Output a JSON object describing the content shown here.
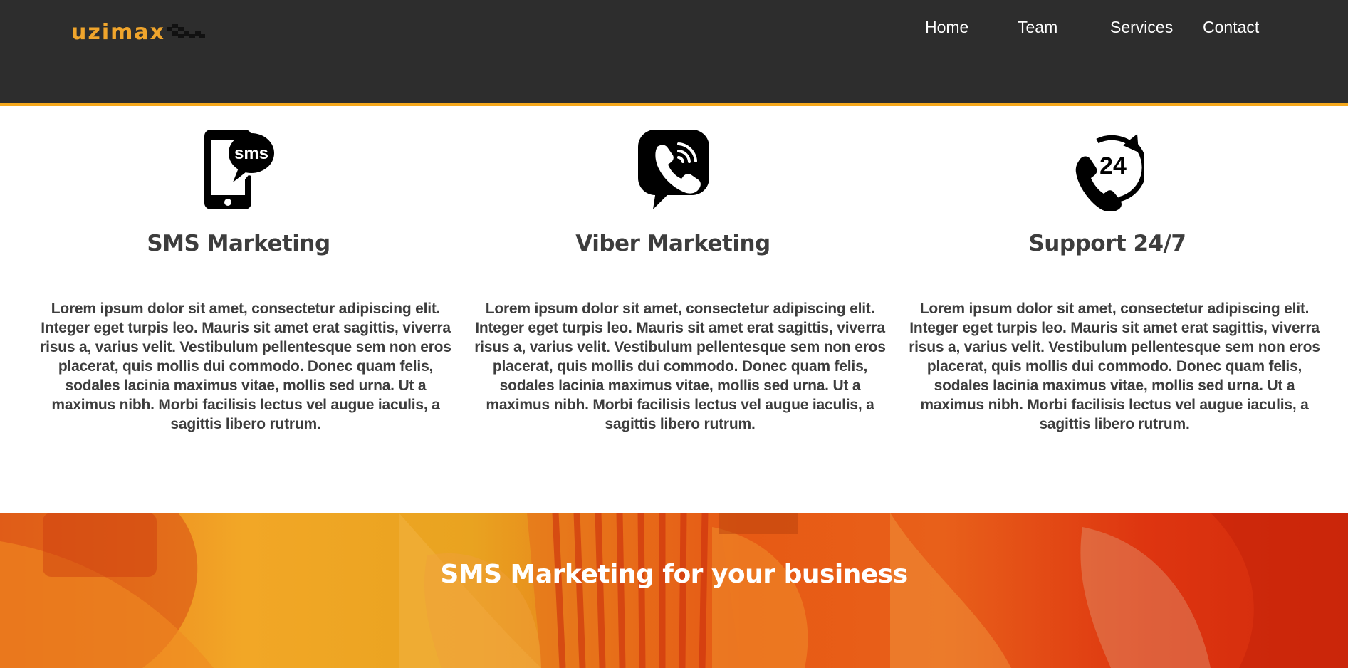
{
  "header": {
    "logo_text": "uzimax",
    "nav": {
      "home": "Home",
      "team": "Team",
      "services": "Services",
      "contact": "Contact"
    }
  },
  "colors": {
    "header_bg": "#2d2d2d",
    "accent": "#f5a81c",
    "logo_text": "#f0a52c",
    "body_text": "#3d3d3d"
  },
  "features": [
    {
      "icon": "sms-phone-icon",
      "icon_text": "sms",
      "title": "SMS Marketing",
      "text": "Lorem ipsum dolor sit amet, consectetur adipiscing elit. Integer eget turpis leo. Mauris sit amet erat sagittis, viverra risus a, varius velit. Vestibulum pellentesque sem non eros placerat, quis mollis dui commodo. Donec quam felis, sodales lacinia maximus vitae, mollis sed urna. Ut a maximus nibh. Morbi facilisis lectus vel augue iaculis, a sagittis libero rutrum."
    },
    {
      "icon": "viber-icon",
      "title": "Viber Marketing",
      "text": "Lorem ipsum dolor sit amet, consectetur adipiscing elit. Integer eget turpis leo. Mauris sit amet erat sagittis, viverra risus a, varius velit. Vestibulum pellentesque sem non eros placerat, quis mollis dui commodo. Donec quam felis, sodales lacinia maximus vitae, mollis sed urna. Ut a maximus nibh. Morbi facilisis lectus vel augue iaculis, a sagittis libero rutrum."
    },
    {
      "icon": "support-24-7-icon",
      "icon_text": "24",
      "title": "Support 24/7",
      "text": "Lorem ipsum dolor sit amet, consectetur adipiscing elit. Integer eget turpis leo. Mauris sit amet erat sagittis, viverra risus a, varius velit. Vestibulum pellentesque sem non eros placerat, quis mollis dui commodo. Donec quam felis, sodales lacinia maximus vitae, mollis sed urna. Ut a maximus nibh. Morbi facilisis lectus vel augue iaculis, a sagittis libero rutrum."
    }
  ],
  "hero": {
    "title": "SMS Marketing for your business"
  }
}
